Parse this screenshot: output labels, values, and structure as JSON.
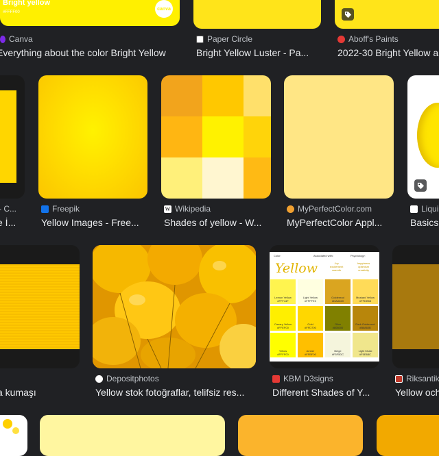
{
  "results": {
    "row1": [
      {
        "source": "Canva",
        "title": "Everything about the color Bright Yellow",
        "thumb_text": "Bright yellow",
        "thumb_sub": "#FFFF00",
        "logo": "canva"
      },
      {
        "source": "Paper Circle",
        "title": "Bright Yellow Luster - Pa..."
      },
      {
        "source": "Aboff's Paints",
        "title": "2022-30 Bright Yellow a"
      }
    ],
    "row2": [
      {
        "source": "- C...",
        "title": "e İ..."
      },
      {
        "source": "Freepik",
        "title": "Yellow Images - Free..."
      },
      {
        "source": "Wikipedia",
        "title": "Shades of yellow - W..."
      },
      {
        "source": "MyPerfectColor.com",
        "title": "MyPerfectColor Appl..."
      },
      {
        "source": "Liqui",
        "title": "Basics"
      }
    ],
    "row3": [
      {
        "source": "",
        "title": "a kumaşı"
      },
      {
        "source": "Depositphotos",
        "title": "Yellow stok fotoğraflar, telifsiz res..."
      },
      {
        "source": "KBM D3signs",
        "title": "Different Shades of Y..."
      },
      {
        "source": "Riksantik",
        "title": "Yellow och"
      }
    ],
    "chart_card": {
      "heading_left": "Color:",
      "heading_mid": "Associated with:",
      "heading_right": "Psychology:",
      "big_word": "Yellow",
      "assoc": "Joy\nexcitement\nwarmth",
      "psych": "happiness\noptimism\ncreativity",
      "swatches": [
        {
          "name": "Lemon Yellow",
          "hex": "#FFF44F",
          "color": "#FFF44F"
        },
        {
          "name": "Light Yellow",
          "hex": "#FFFFE0",
          "color": "#FFFFE0"
        },
        {
          "name": "Goldenrod",
          "hex": "#DAA520",
          "color": "#DAA520"
        },
        {
          "name": "Mustard Yellow",
          "hex": "#FFDB58",
          "color": "#FFDB58"
        },
        {
          "name": "Canary Yellow",
          "hex": "#FFEF00",
          "color": "#FFEF00"
        },
        {
          "name": "Gold",
          "hex": "#FFD700",
          "color": "#FFD700"
        },
        {
          "name": "Olive",
          "hex": "#808000",
          "color": "#808000"
        },
        {
          "name": "Dark Goldenrod",
          "hex": "#B8860B",
          "color": "#B8860B"
        },
        {
          "name": "Yellow",
          "hex": "#FFFF00",
          "color": "#FFFF00"
        },
        {
          "name": "Amber",
          "hex": "#FFBF00",
          "color": "#FFBF00"
        },
        {
          "name": "Beige",
          "hex": "#F5F5DC",
          "color": "#F5F5DC"
        },
        {
          "name": "Light Khaki",
          "hex": "#F0E68C",
          "color": "#F0E68C"
        }
      ]
    }
  },
  "colors": {
    "background": "#202124",
    "text": "#e8eaed",
    "source_text": "#bdc1c6"
  }
}
